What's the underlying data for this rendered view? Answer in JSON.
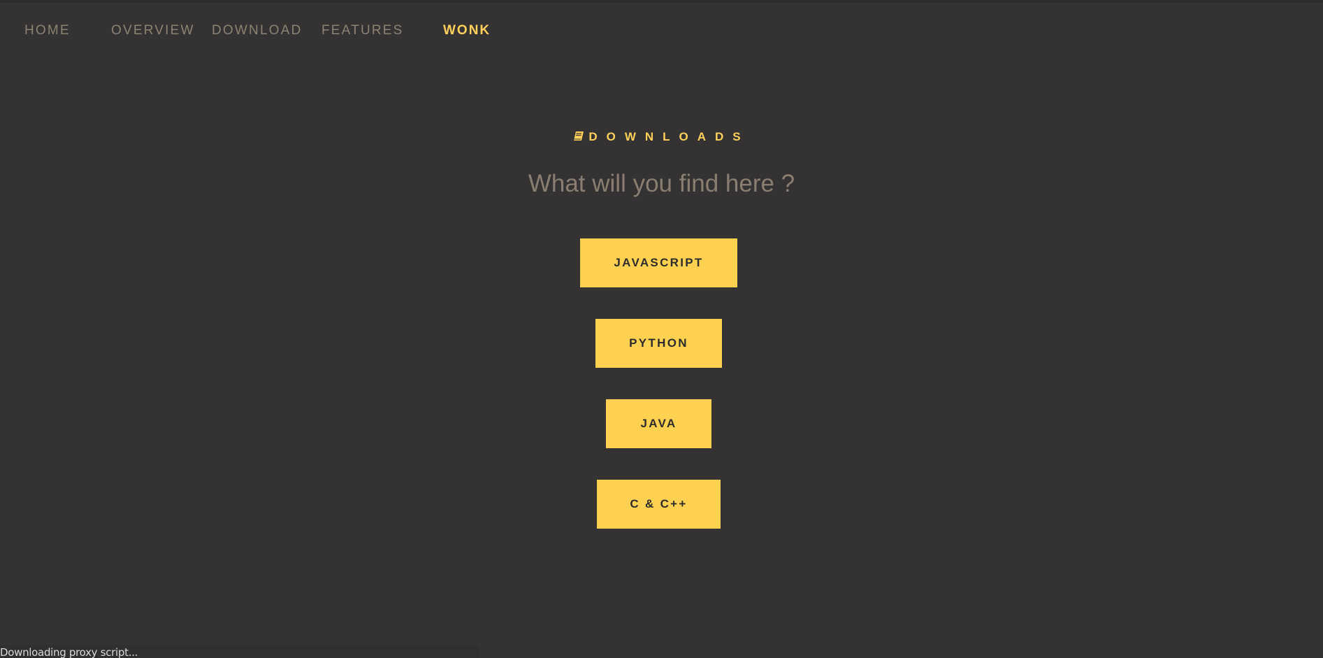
{
  "nav": {
    "items": [
      {
        "label": "HOME"
      },
      {
        "label": "OVERVIEW"
      },
      {
        "label": "DOWNLOAD"
      },
      {
        "label": "FEATURES"
      },
      {
        "label": "WONK"
      }
    ]
  },
  "section": {
    "title": "DOWNLOADS",
    "icon": "book-icon",
    "subtitle": "What will you find here ?"
  },
  "buttons": [
    {
      "label": "JAVASCRIPT"
    },
    {
      "label": "PYTHON"
    },
    {
      "label": "JAVA"
    },
    {
      "label": "C & C++"
    }
  ],
  "status": {
    "text": "Downloading proxy script..."
  },
  "colors": {
    "background": "#343233",
    "accent": "#ffd151",
    "nav_text": "#8e8272",
    "subtitle_text": "#8a7e70",
    "button_text": "#2d2b2c"
  }
}
